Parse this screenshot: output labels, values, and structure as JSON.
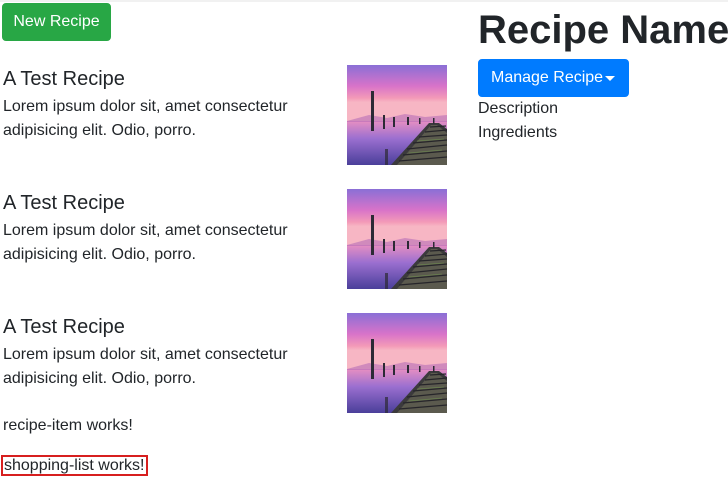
{
  "header": {
    "new_recipe_label": "New Recipe"
  },
  "recipes": [
    {
      "name": "A Test Recipe",
      "description": "Lorem ipsum dolor sit, amet consectetur adipisicing elit. Odio, porro."
    },
    {
      "name": "A Test Recipe",
      "description": "Lorem ipsum dolor sit, amet consectetur adipisicing elit. Odio, porro."
    },
    {
      "name": "A Test Recipe",
      "description": "Lorem ipsum dolor sit, amet consectetur adipisicing elit. Odio, porro."
    }
  ],
  "recipe_item_status": "recipe-item works!",
  "shopping_list_status": "shopping-list works!",
  "detail": {
    "title": "Recipe Name",
    "manage_label": "Manage Recipe",
    "description_label": "Description",
    "ingredients_label": "Ingredients"
  },
  "colors": {
    "success": "#28a745",
    "primary": "#007bff",
    "highlight_border": "#d71f1f"
  },
  "icons": {
    "manage_dropdown": "caret-down-icon",
    "recipe_thumbnail": "pier-sunset-image"
  }
}
